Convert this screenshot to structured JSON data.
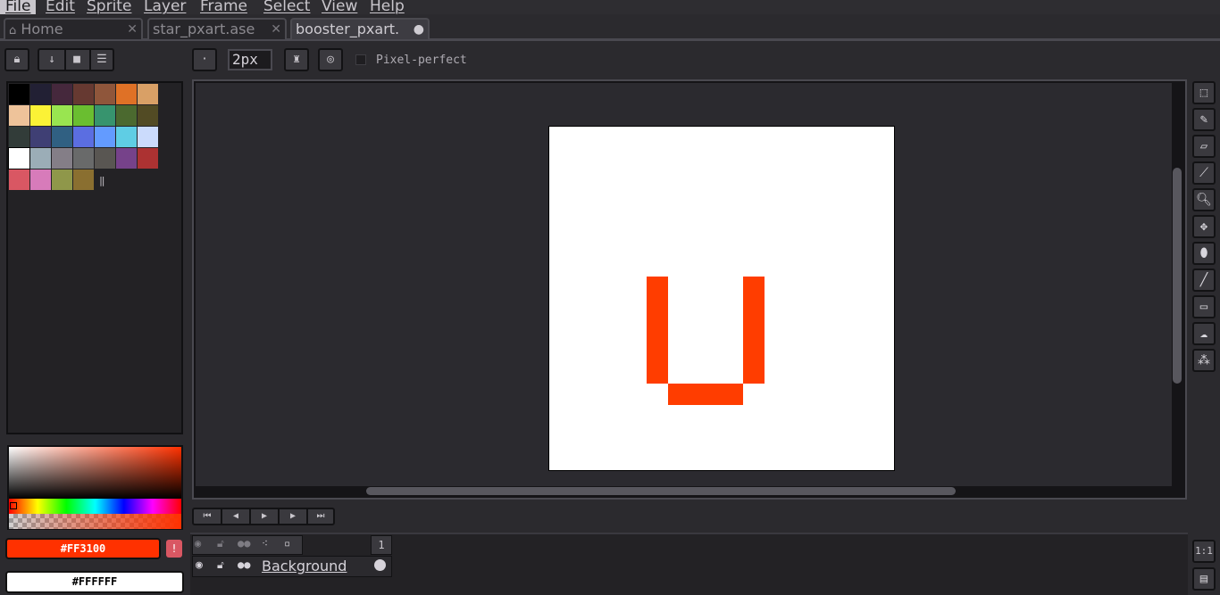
{
  "menu": {
    "items": [
      "File",
      "Edit",
      "Sprite",
      "Layer",
      "Frame",
      "Select",
      "View",
      "Help"
    ]
  },
  "tabs": [
    {
      "label": "Home",
      "icon": "home-icon"
    },
    {
      "label": "star_pxart.ase",
      "icon": null
    },
    {
      "label": "booster_pxart.",
      "icon": null
    }
  ],
  "toolbar": {
    "brush_size": "2px",
    "pixel_perfect_label": "Pixel-perfect",
    "pixel_perfect_checked": false
  },
  "palette": {
    "colors": [
      "#000000",
      "#222034",
      "#45283c",
      "#663931",
      "#8f563b",
      "#df7126",
      "#d9a066",
      "#eec39a",
      "#fbf236",
      "#99e550",
      "#6abe30",
      "#37946e",
      "#4b692f",
      "#524b24",
      "#323c39",
      "#3f3f74",
      "#306082",
      "#5b6ee1",
      "#639bff",
      "#5fcde4",
      "#cbdbfc",
      "#ffffff",
      "#9badb7",
      "#847e87",
      "#696a6a",
      "#595652",
      "#76428a",
      "#ac3232",
      "#d95763",
      "#d77bba",
      "#8f974a",
      "#8a6f30"
    ]
  },
  "colors": {
    "foreground_hex": "#FF3100",
    "background_hex": "#FFFFFF",
    "accent": "#ff3100",
    "ui_background": "#2b2a2e"
  },
  "timeline": {
    "frame_number": "1",
    "layers": [
      {
        "name": "Background"
      }
    ]
  },
  "zoom_label": "1:1"
}
